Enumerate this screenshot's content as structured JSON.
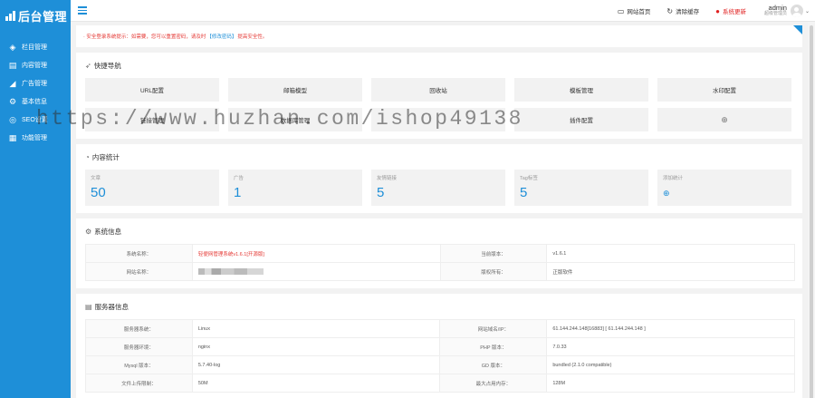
{
  "app": {
    "logo_text": "后台管理"
  },
  "sidebar": {
    "items": [
      {
        "label": "栏目管理",
        "icon": "layers-icon"
      },
      {
        "label": "内容管理",
        "icon": "document-icon"
      },
      {
        "label": "广告管理",
        "icon": "megaphone-icon"
      },
      {
        "label": "基本信息",
        "icon": "gear-icon"
      },
      {
        "label": "SEO设置",
        "icon": "search-icon"
      },
      {
        "label": "功能管理",
        "icon": "grid-icon"
      }
    ]
  },
  "topbar": {
    "site_home": "网站首页",
    "clear_cache": "清除缓存",
    "system_update": "系统更新",
    "user_name": "admin",
    "user_role": "超级管理员"
  },
  "notice": {
    "prefix": "· 安全登录系统提示：如需要，您可以重置密码，请及时",
    "link": "【修改密码】",
    "suffix": "提高安全性。"
  },
  "quick_nav": {
    "title": "快捷导航",
    "items": [
      "URL配置",
      "邮箱模型",
      "回收站",
      "模板管理",
      "水印配置",
      "链接管理",
      "数据库管理",
      "",
      "插件配置",
      "+"
    ]
  },
  "content_stats": {
    "title": "内容统计",
    "items": [
      {
        "label": "文章",
        "value": "50"
      },
      {
        "label": "广告",
        "value": "1"
      },
      {
        "label": "友情链接",
        "value": "5"
      },
      {
        "label": "Tag标签",
        "value": "5"
      },
      {
        "label": "添加统计",
        "value": ""
      }
    ]
  },
  "system_info": {
    "title": "系统信息",
    "rows": [
      [
        "系统名称：",
        "轻便网管理系统v1.6.1[开源版]",
        "当前版本：",
        "v1.6.1"
      ],
      [
        "网站名称：",
        "",
        "版权所有：",
        "正版软件"
      ]
    ]
  },
  "server_info": {
    "title": "服务器信息",
    "rows": [
      [
        "服务器系统：",
        "Linux",
        "网站域名/IP：",
        "61.144.244.148[16883] [ 61.144.244.148 ]"
      ],
      [
        "服务器环境：",
        "nginx",
        "PHP 版本：",
        "7.0.33"
      ],
      [
        "Mysql 版本：",
        "5.7.40-log",
        "GD 版本：",
        "bundled (2.1.0 compatible)"
      ],
      [
        "文件上传限制：",
        "50M",
        "最大占用内存：",
        "128M"
      ]
    ]
  },
  "watermark": "https://www.huzhan.com/ishop49138",
  "colors": {
    "primary": "#1e8fd8",
    "danger": "#e53935"
  }
}
